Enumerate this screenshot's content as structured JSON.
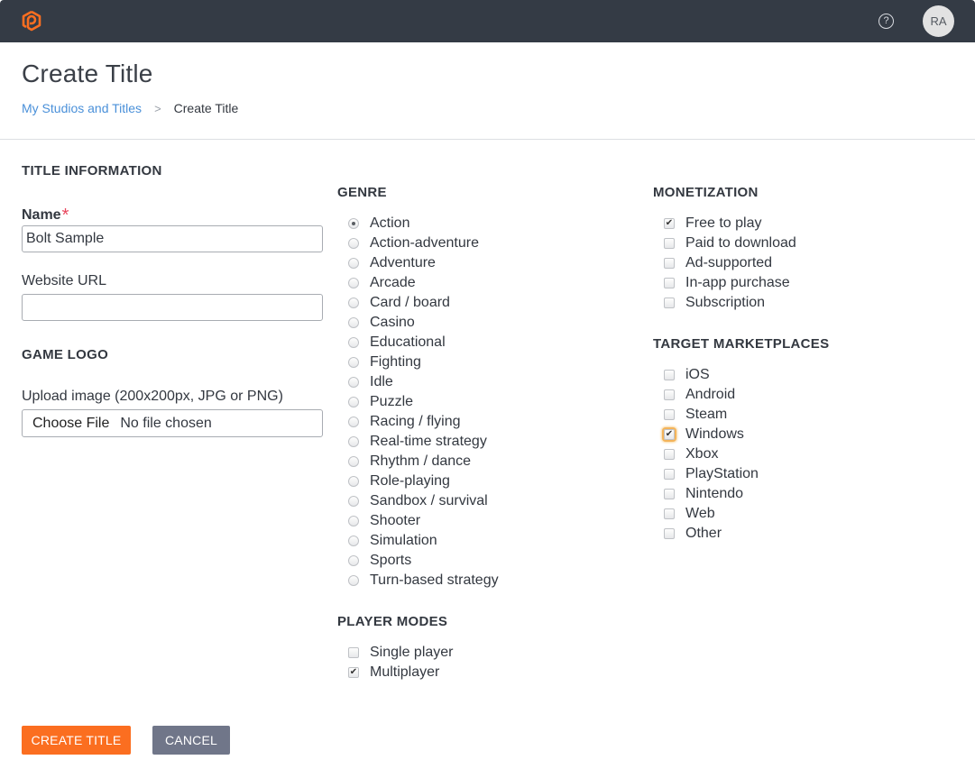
{
  "header": {
    "avatar_initials": "RA",
    "help_glyph": "?",
    "icons": {
      "logo": "app-logo-icon",
      "help": "help-circle-icon"
    },
    "brand_color": "#fb6e20"
  },
  "page": {
    "title": "Create Title",
    "breadcrumb": [
      {
        "label": "My Studios and Titles",
        "link": true
      },
      {
        "label": "Create Title",
        "link": false
      }
    ],
    "breadcrumb_separator": ">"
  },
  "title_info": {
    "heading": "TITLE INFORMATION",
    "name_label": "Name",
    "required_mark": "*",
    "name_value": "Bolt Sample",
    "website_label": "Website URL",
    "website_value": ""
  },
  "game_logo": {
    "heading": "GAME LOGO",
    "upload_label": "Upload image (200x200px, JPG or PNG)",
    "choose_file": "Choose File",
    "file_status": "No file chosen"
  },
  "genre": {
    "heading": "GENRE",
    "selected": "Action",
    "options": [
      "Action",
      "Action-adventure",
      "Adventure",
      "Arcade",
      "Card / board",
      "Casino",
      "Educational",
      "Fighting",
      "Idle",
      "Puzzle",
      "Racing / flying",
      "Real-time strategy",
      "Rhythm / dance",
      "Role-playing",
      "Sandbox / survival",
      "Shooter",
      "Simulation",
      "Sports",
      "Turn-based strategy"
    ]
  },
  "player_modes": {
    "heading": "PLAYER MODES",
    "options": [
      {
        "label": "Single player",
        "checked": false
      },
      {
        "label": "Multiplayer",
        "checked": true
      }
    ]
  },
  "monetization": {
    "heading": "MONETIZATION",
    "options": [
      {
        "label": "Free to play",
        "checked": true
      },
      {
        "label": "Paid to download",
        "checked": false
      },
      {
        "label": "Ad-supported",
        "checked": false
      },
      {
        "label": "In-app purchase",
        "checked": false
      },
      {
        "label": "Subscription",
        "checked": false
      }
    ]
  },
  "marketplaces": {
    "heading": "TARGET MARKETPLACES",
    "options": [
      {
        "label": "iOS",
        "checked": false
      },
      {
        "label": "Android",
        "checked": false
      },
      {
        "label": "Steam",
        "checked": false
      },
      {
        "label": "Windows",
        "checked": true,
        "focused": true
      },
      {
        "label": "Xbox",
        "checked": false
      },
      {
        "label": "PlayStation",
        "checked": false
      },
      {
        "label": "Nintendo",
        "checked": false
      },
      {
        "label": "Web",
        "checked": false
      },
      {
        "label": "Other",
        "checked": false
      }
    ]
  },
  "actions": {
    "create_label": "CREATE TITLE",
    "cancel_label": "CANCEL"
  }
}
